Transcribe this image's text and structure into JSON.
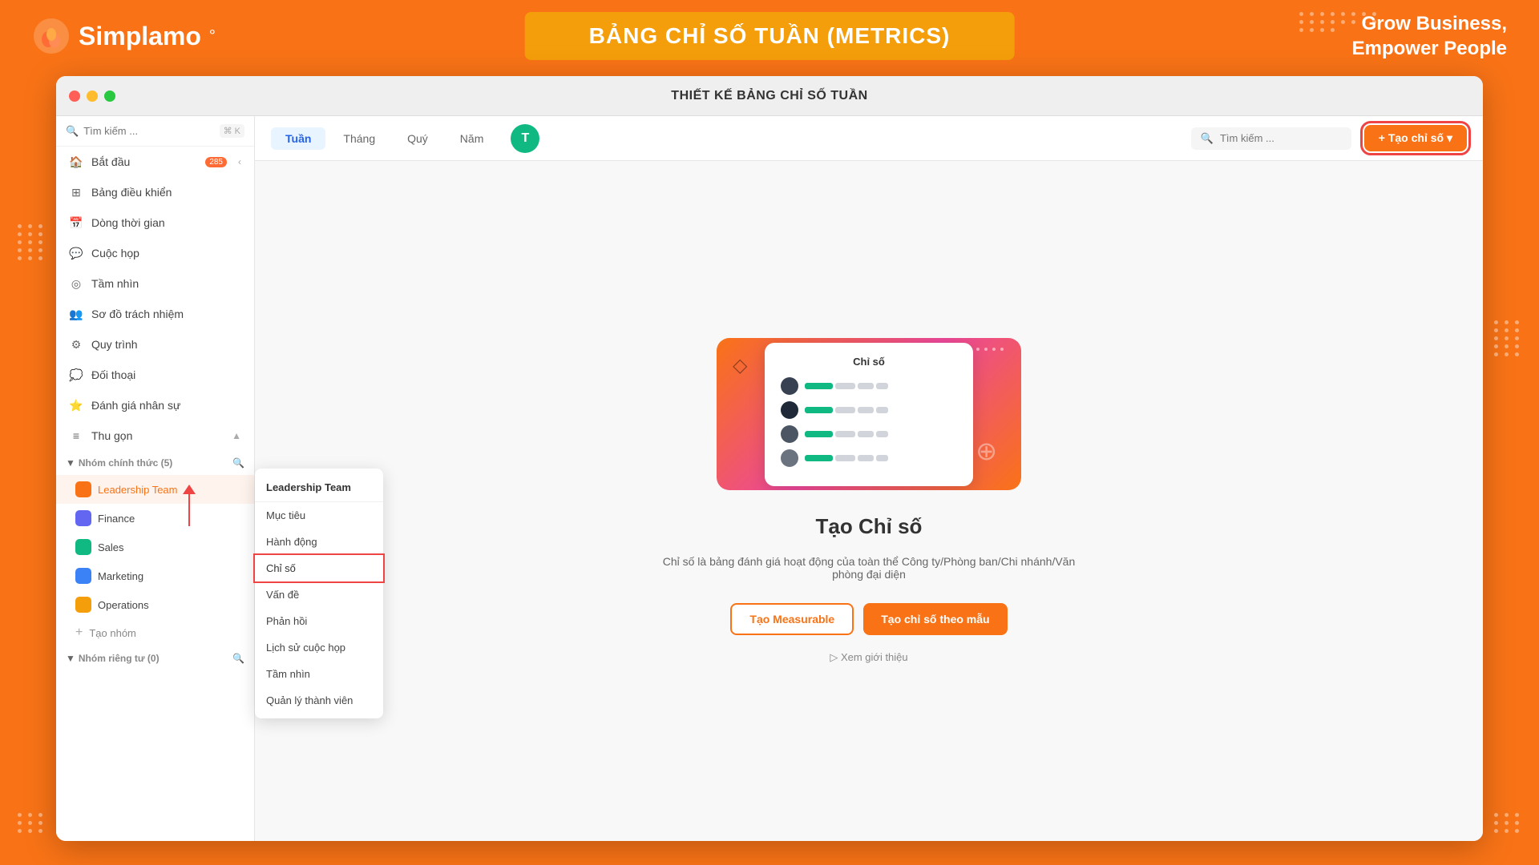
{
  "banner": {
    "logo_text": "Simplamo",
    "logo_symbol": "°",
    "title": "BẢNG CHỈ SỐ TUẦN (METRICS)",
    "tagline_line1": "Grow Business,",
    "tagline_line2": "Empower People"
  },
  "window": {
    "title": "THIẾT KẾ BẢNG CHỈ SỐ TUẦN"
  },
  "sidebar": {
    "search_placeholder": "Tìm kiếm ...",
    "search_shortcut": "⌘ K",
    "nav_items": [
      {
        "id": "bat-dau",
        "label": "Bắt đầu",
        "badge": "285"
      },
      {
        "id": "bang-dieu-khien",
        "label": "Bảng điều khiển"
      },
      {
        "id": "dong-thoi-gian",
        "label": "Dòng thời gian"
      },
      {
        "id": "cuoc-hop",
        "label": "Cuộc họp"
      },
      {
        "id": "tam-nhin",
        "label": "Tầm nhìn"
      },
      {
        "id": "so-do-trach-nhiem",
        "label": "Sơ đồ trách nhiệm"
      },
      {
        "id": "quy-trinh",
        "label": "Quy trình"
      },
      {
        "id": "doi-thoai",
        "label": "Đối thoại"
      },
      {
        "id": "danh-gia-nhan-su",
        "label": "Đánh giá nhân sự"
      },
      {
        "id": "thu-gon",
        "label": "Thu gọn"
      }
    ],
    "official_group": {
      "label": "Nhóm chính thức (5)",
      "teams": [
        {
          "id": "leadership-team",
          "label": "Leadership Team",
          "color": "#f97316",
          "active": true
        },
        {
          "id": "finance",
          "label": "Finance",
          "color": "#6366f1"
        },
        {
          "id": "sales",
          "label": "Sales",
          "color": "#10b981"
        },
        {
          "id": "marketing",
          "label": "Marketing",
          "color": "#3b82f6"
        },
        {
          "id": "operations",
          "label": "Operations",
          "color": "#f59e0b"
        }
      ],
      "add_label": "Tạo nhóm"
    },
    "private_group": {
      "label": "Nhóm riêng tư (0)"
    }
  },
  "toolbar": {
    "tabs": [
      {
        "id": "tuan",
        "label": "Tuần",
        "active": true
      },
      {
        "id": "thang",
        "label": "Tháng"
      },
      {
        "id": "quy",
        "label": "Quý"
      },
      {
        "id": "nam",
        "label": "Năm"
      }
    ],
    "avatar_initial": "T",
    "search_placeholder": "Tìm kiếm ...",
    "create_btn_label": "+ Tạo chỉ số ▾"
  },
  "main": {
    "illustration_card_title": "Chỉ số",
    "center_title": "Tạo Chỉ số",
    "center_desc": "Chỉ số là bảng đánh giá hoạt động của toàn thể Công ty/Phòng ban/Chi nhánh/Văn phòng đại diện",
    "btn_measurable": "Tạo Measurable",
    "btn_template": "Tạo chỉ số theo mẫu",
    "intro_link": "▷ Xem giới thiệu"
  },
  "dropdown": {
    "header": "Leadership Team",
    "items": [
      {
        "id": "muc-tieu",
        "label": "Mục tiêu"
      },
      {
        "id": "hanh-dong",
        "label": "Hành động"
      },
      {
        "id": "chi-so",
        "label": "Chỉ số",
        "highlighted": true
      },
      {
        "id": "van-de",
        "label": "Vấn đề"
      },
      {
        "id": "phan-hoi",
        "label": "Phản hồi"
      },
      {
        "id": "lich-su-cuoc-hop",
        "label": "Lịch sử cuộc họp"
      },
      {
        "id": "tam-nhin",
        "label": "Tầm nhìn"
      },
      {
        "id": "quan-ly-thanh-vien",
        "label": "Quản lý thành viên"
      }
    ]
  }
}
